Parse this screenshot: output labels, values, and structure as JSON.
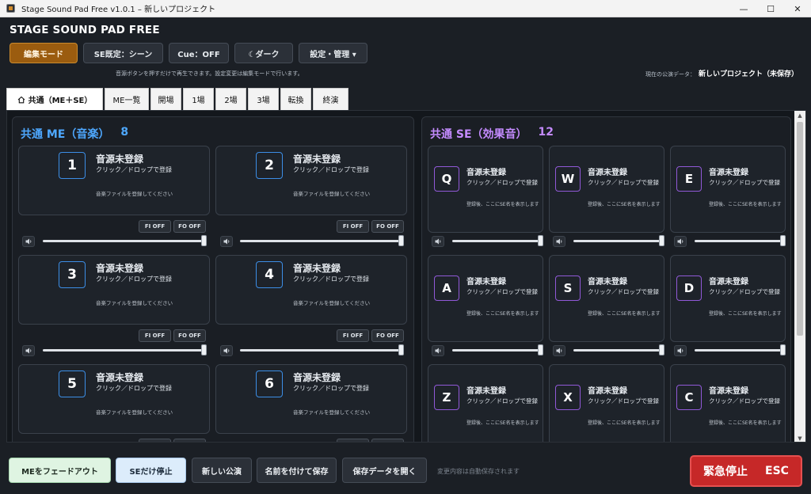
{
  "window": {
    "title": "Stage Sound Pad Free v1.0.1 – 新しいプロジェクト",
    "controls": [
      "—",
      "☐",
      "✕"
    ]
  },
  "app": {
    "title": "STAGE SOUND PAD FREE"
  },
  "toolbar": {
    "edit_mode": "編集モード",
    "se_default": "SE既定：シーン",
    "cue": "Cue：OFF",
    "dark": "☾ダーク",
    "settings": "設定・管理 ▾"
  },
  "hint": "音源ボタンを押すだけで再生できます。設定変更は編集モードで行います。",
  "current": {
    "label": "現在の公演データ：",
    "value": "新しいプロジェクト（未保存）"
  },
  "tabs": [
    "共通（ME＋SE）",
    "ME一覧",
    "開場",
    "1場",
    "2場",
    "3場",
    "転換",
    "終演"
  ],
  "me_panel": {
    "title": "共通 ME（音楽）",
    "count": "8",
    "cards": [
      {
        "num": "1",
        "line1": "音源未登録",
        "line2": "クリック／ドロップで登録",
        "line3": "音楽ファイルを登録してください",
        "fi": "FI OFF",
        "fo": "FO OFF"
      },
      {
        "num": "2",
        "line1": "音源未登録",
        "line2": "クリック／ドロップで登録",
        "line3": "音楽ファイルを登録してください",
        "fi": "FI OFF",
        "fo": "FO OFF"
      },
      {
        "num": "3",
        "line1": "音源未登録",
        "line2": "クリック／ドロップで登録",
        "line3": "音楽ファイルを登録してください",
        "fi": "FI OFF",
        "fo": "FO OFF"
      },
      {
        "num": "4",
        "line1": "音源未登録",
        "line2": "クリック／ドロップで登録",
        "line3": "音楽ファイルを登録してください",
        "fi": "FI OFF",
        "fo": "FO OFF"
      },
      {
        "num": "5",
        "line1": "音源未登録",
        "line2": "クリック／ドロップで登録",
        "line3": "音楽ファイルを登録してください"
      },
      {
        "num": "6",
        "line1": "音源未登録",
        "line2": "クリック／ドロップで登録",
        "line3": "音楽ファイルを登録してください"
      }
    ]
  },
  "se_panel": {
    "title": "共通 SE（効果音）",
    "count": "12",
    "cards": [
      {
        "key": "Q",
        "line1": "音源未登録",
        "line2": "クリック／ドロップで登録",
        "line3": "登録後、ここにSE名を表示します"
      },
      {
        "key": "W",
        "line1": "音源未登録",
        "line2": "クリック／ドロップで登録",
        "line3": "登録後、ここにSE名を表示します"
      },
      {
        "key": "E",
        "line1": "音源未登録",
        "line2": "クリック／ドロップで登録",
        "line3": "登録後、ここにSE名を表示します"
      },
      {
        "key": "A",
        "line1": "音源未登録",
        "line2": "クリック／ドロップで登録",
        "line3": "登録後、ここにSE名を表示します"
      },
      {
        "key": "S",
        "line1": "音源未登録",
        "line2": "クリック／ドロップで登録",
        "line3": "登録後、ここにSE名を表示します"
      },
      {
        "key": "D",
        "line1": "音源未登録",
        "line2": "クリック／ドロップで登録",
        "line3": "登録後、ここにSE名を表示します"
      },
      {
        "key": "Z",
        "line1": "音源未登録",
        "line2": "クリック／ドロップで登録",
        "line3": "登録後、ここにSE名を表示します"
      },
      {
        "key": "X",
        "line1": "音源未登録",
        "line2": "クリック／ドロップで登録",
        "line3": "登録後、ここにSE名を表示します"
      },
      {
        "key": "C",
        "line1": "音源未登録",
        "line2": "クリック／ドロップで登録",
        "line3": "登録後、ここにSE名を表示します"
      }
    ]
  },
  "footer": {
    "fade_me": "MEをフェードアウト",
    "stop_se": "SEだけ停止",
    "new_show": "新しい公演",
    "save_as": "名前を付けて保存",
    "open_data": "保存データを開く",
    "autosave": "変更内容は自動保存されます",
    "emergency": "緊急停止",
    "emergency_key": "ESC"
  },
  "colors": {
    "background": "#1b1f25",
    "edit_mode_accent": "#9b5c0f",
    "me_accent": "#4ea8ff",
    "se_accent": "#c48bff",
    "emergency": "#c62828"
  },
  "icons": {
    "home": "home-icon",
    "speaker": "speaker-icon",
    "moon": "moon-icon"
  },
  "volume_level": 1.0
}
